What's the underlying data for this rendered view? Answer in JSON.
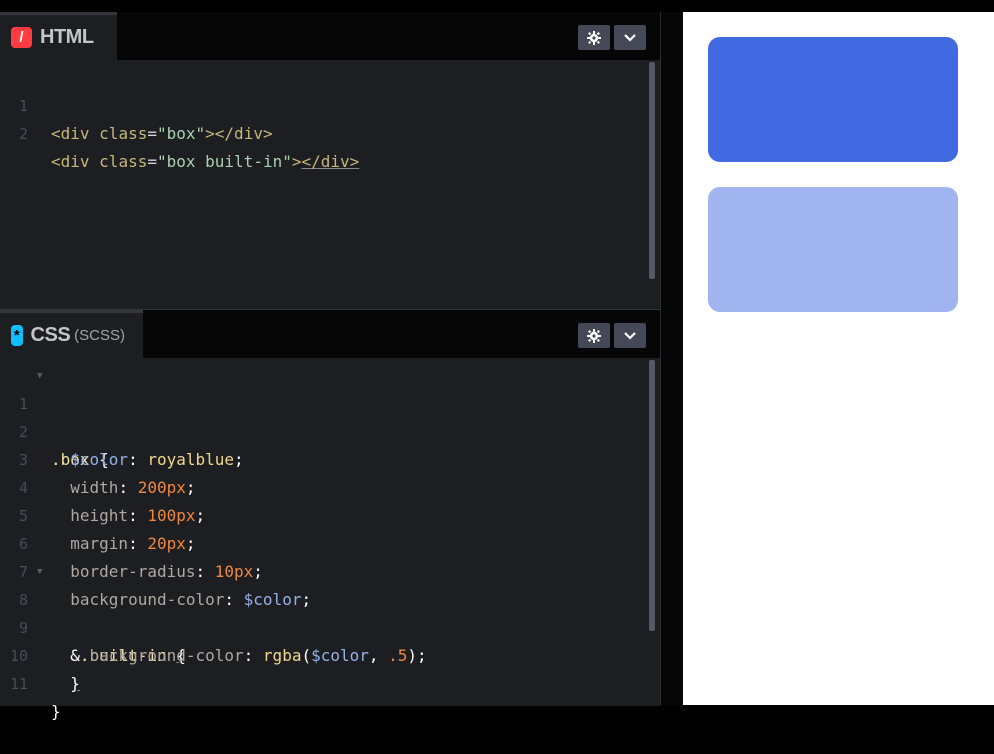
{
  "colors": {
    "html_icon": "#ff3c41",
    "css_icon": "#0ebeff",
    "box": "#4169e1",
    "box_built_in": "rgba(65,105,225,0.5)"
  },
  "html_panel": {
    "icon_glyph": "/",
    "title": "HTML",
    "buttons": [
      "gear-icon",
      "chevron-down-icon"
    ],
    "line_numbers": [
      "1",
      "2"
    ],
    "lines": [
      [
        "<div ",
        "class",
        "=",
        "\"box\"",
        "></div>"
      ],
      [
        "<div ",
        "class",
        "=",
        "\"box built-in\"",
        ">",
        "</div>"
      ]
    ]
  },
  "css_panel": {
    "icon_glyph": "*",
    "title": "CSS",
    "subtitle": "(SCSS)",
    "buttons": [
      "gear-icon",
      "chevron-down-icon"
    ],
    "line_numbers": [
      "1",
      "2",
      "3",
      "4",
      "5",
      "6",
      "7",
      "8",
      "9",
      "10",
      "11"
    ],
    "lines": {
      "l1": [
        ".box",
        " {"
      ],
      "l2": [
        "$color",
        ": ",
        "royalblue",
        ";"
      ],
      "l3": [
        "width",
        ": ",
        "200px",
        ";"
      ],
      "l4": [
        "height",
        ": ",
        "100px",
        ";"
      ],
      "l5": [
        "margin",
        ": ",
        "20px",
        ";"
      ],
      "l6": [
        "border-radius",
        ": ",
        "10px",
        ";"
      ],
      "l7": [
        "background-color",
        ": ",
        "$color",
        ";"
      ],
      "l8": [
        "&",
        ".built-in",
        " ",
        "{"
      ],
      "l9": [
        "background-color",
        ": ",
        "rgba",
        "(",
        "$color",
        ", ",
        ".5",
        ");"
      ],
      "l10": [
        "}"
      ],
      "l11": [
        "}"
      ]
    }
  }
}
